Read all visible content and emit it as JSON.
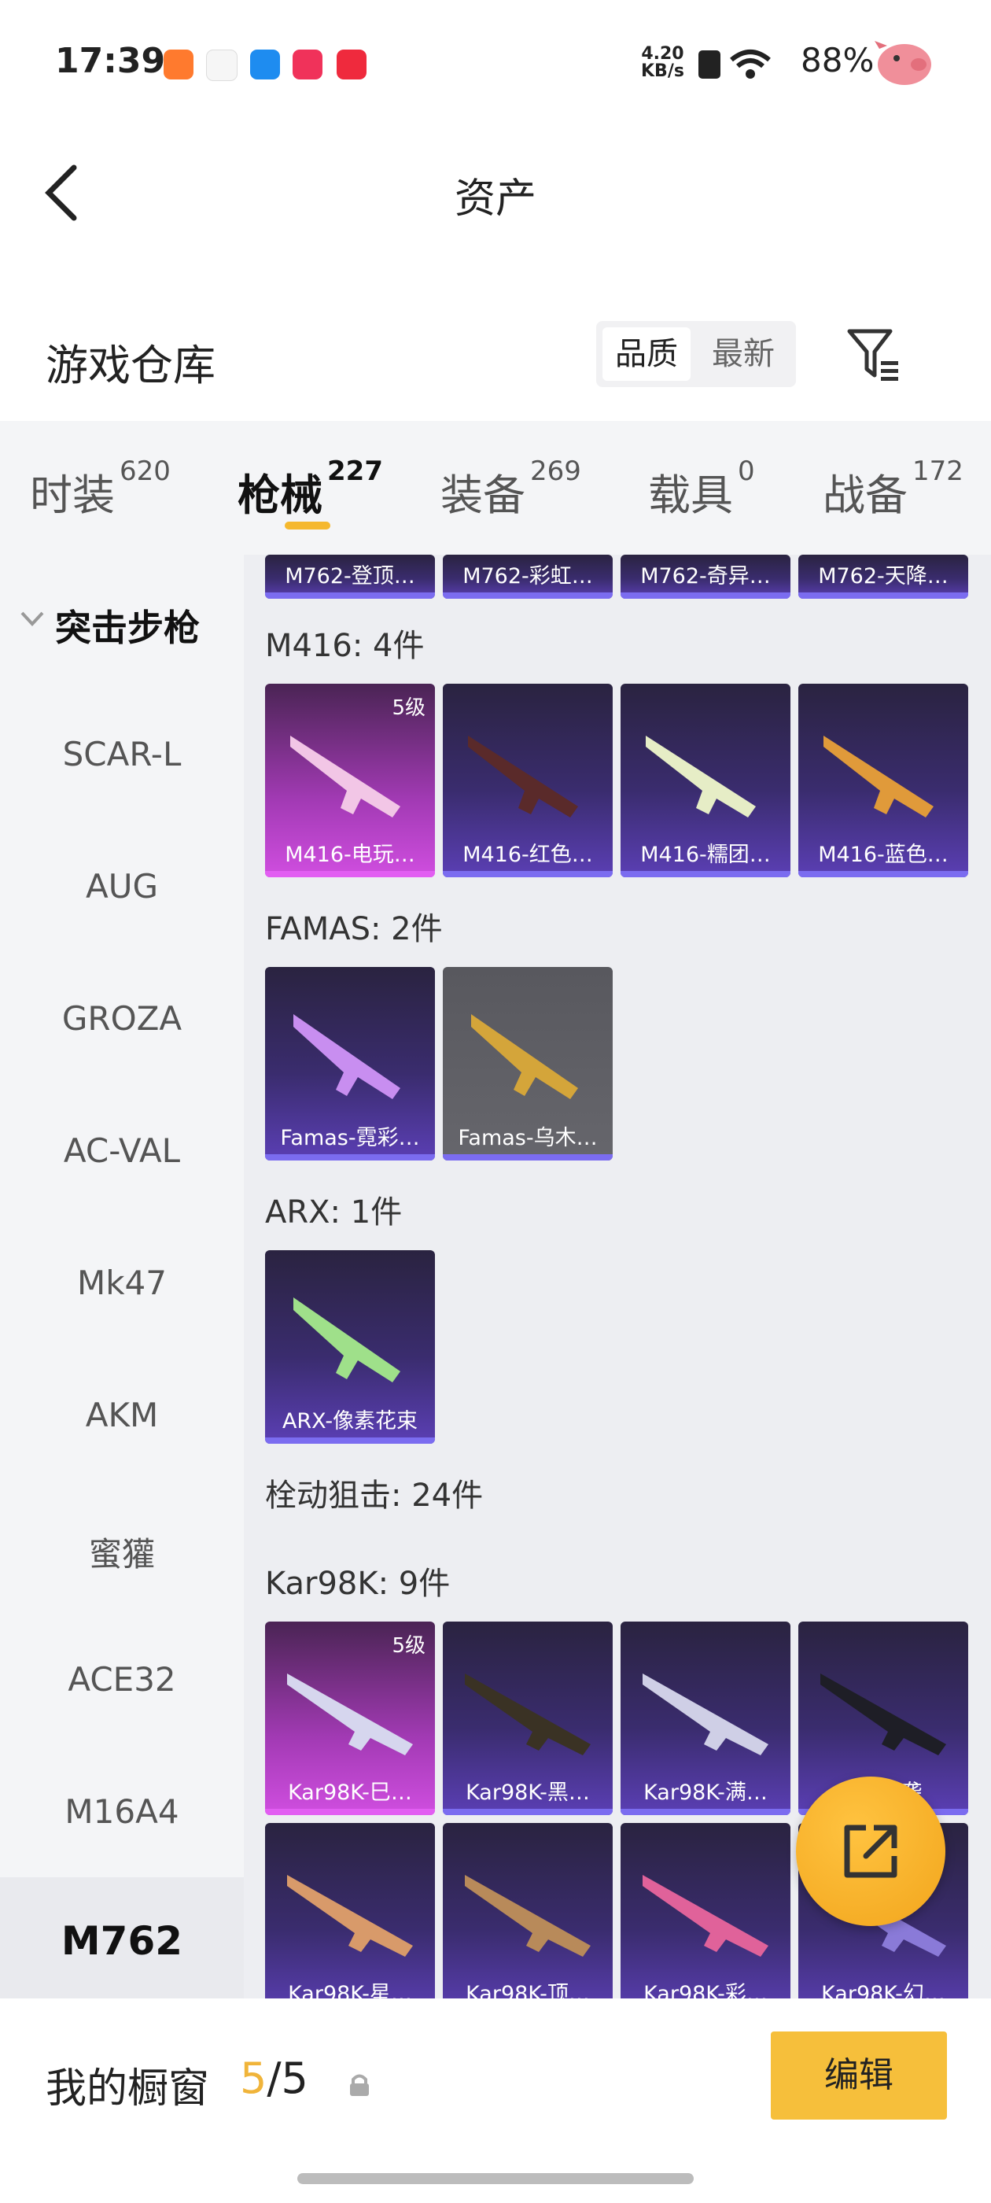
{
  "status_bar": {
    "time": "17:39",
    "net_speed_value": "4.20",
    "net_speed_unit": "KB/s",
    "battery": "88%",
    "app_icons": [
      "kuaishou-icon",
      "app-icon",
      "browser-icon",
      "video-icon",
      "xiaohongshu-icon"
    ]
  },
  "header": {
    "title": "资产",
    "back_icon": "chevron-left-icon"
  },
  "warehouse": {
    "title": "游戏仓库",
    "sort_options": [
      "品质",
      "最新"
    ],
    "sort_selected": "品质",
    "filter_icon": "filter-icon"
  },
  "tabs": [
    {
      "label": "时装",
      "count": "620"
    },
    {
      "label": "枪械",
      "count": "227",
      "active": true
    },
    {
      "label": "装备",
      "count": "269"
    },
    {
      "label": "载具",
      "count": "0"
    },
    {
      "label": "战备",
      "count": "172"
    }
  ],
  "sidebar": {
    "group": "突击步枪",
    "items": [
      "SCAR-L",
      "AUG",
      "GROZA",
      "AC-VAL",
      "Mk47",
      "AKM",
      "蜜獾",
      "ACE32",
      "M16A4",
      "M762"
    ],
    "selected": "M762"
  },
  "content": {
    "top_row": [
      "M762-登顶…",
      "M762-彩虹…",
      "M762-奇异…",
      "M762-天降…"
    ],
    "m416": {
      "header": "M416: 4件",
      "items": [
        "M416-电玩…",
        "M416-红色…",
        "M416-糯团…",
        "M416-蓝色…"
      ],
      "level_badge": "5级"
    },
    "famas": {
      "header": "FAMAS: 2件",
      "items": [
        "Famas-霓彩…",
        "Famas-乌木…"
      ]
    },
    "arx": {
      "header": "ARX: 1件",
      "items": [
        "ARX-像素花束"
      ]
    },
    "bolt": {
      "header": "栓动狙击: 24件"
    },
    "kar98k": {
      "header": "Kar98K: 9件",
      "level_badge": "5级",
      "row1": [
        "Kar98K-巳…",
        "Kar98K-黑…",
        "Kar98K-满…",
        "K…影袭"
      ],
      "row2": [
        "Kar98K-星…",
        "Kar98K-顶…",
        "Kar98K-彩…",
        "Kar98K-幻…"
      ]
    }
  },
  "fab_icon": "share-external-icon",
  "bottom": {
    "label": "我的橱窗",
    "count_current": "5",
    "count_total": "/5",
    "lock_icon": "lock-icon",
    "edit_label": "编辑"
  },
  "colors": {
    "accent": "#F6BF3B",
    "tab_indicator": "#F5B82E",
    "count_highlight": "#F0B43A"
  }
}
